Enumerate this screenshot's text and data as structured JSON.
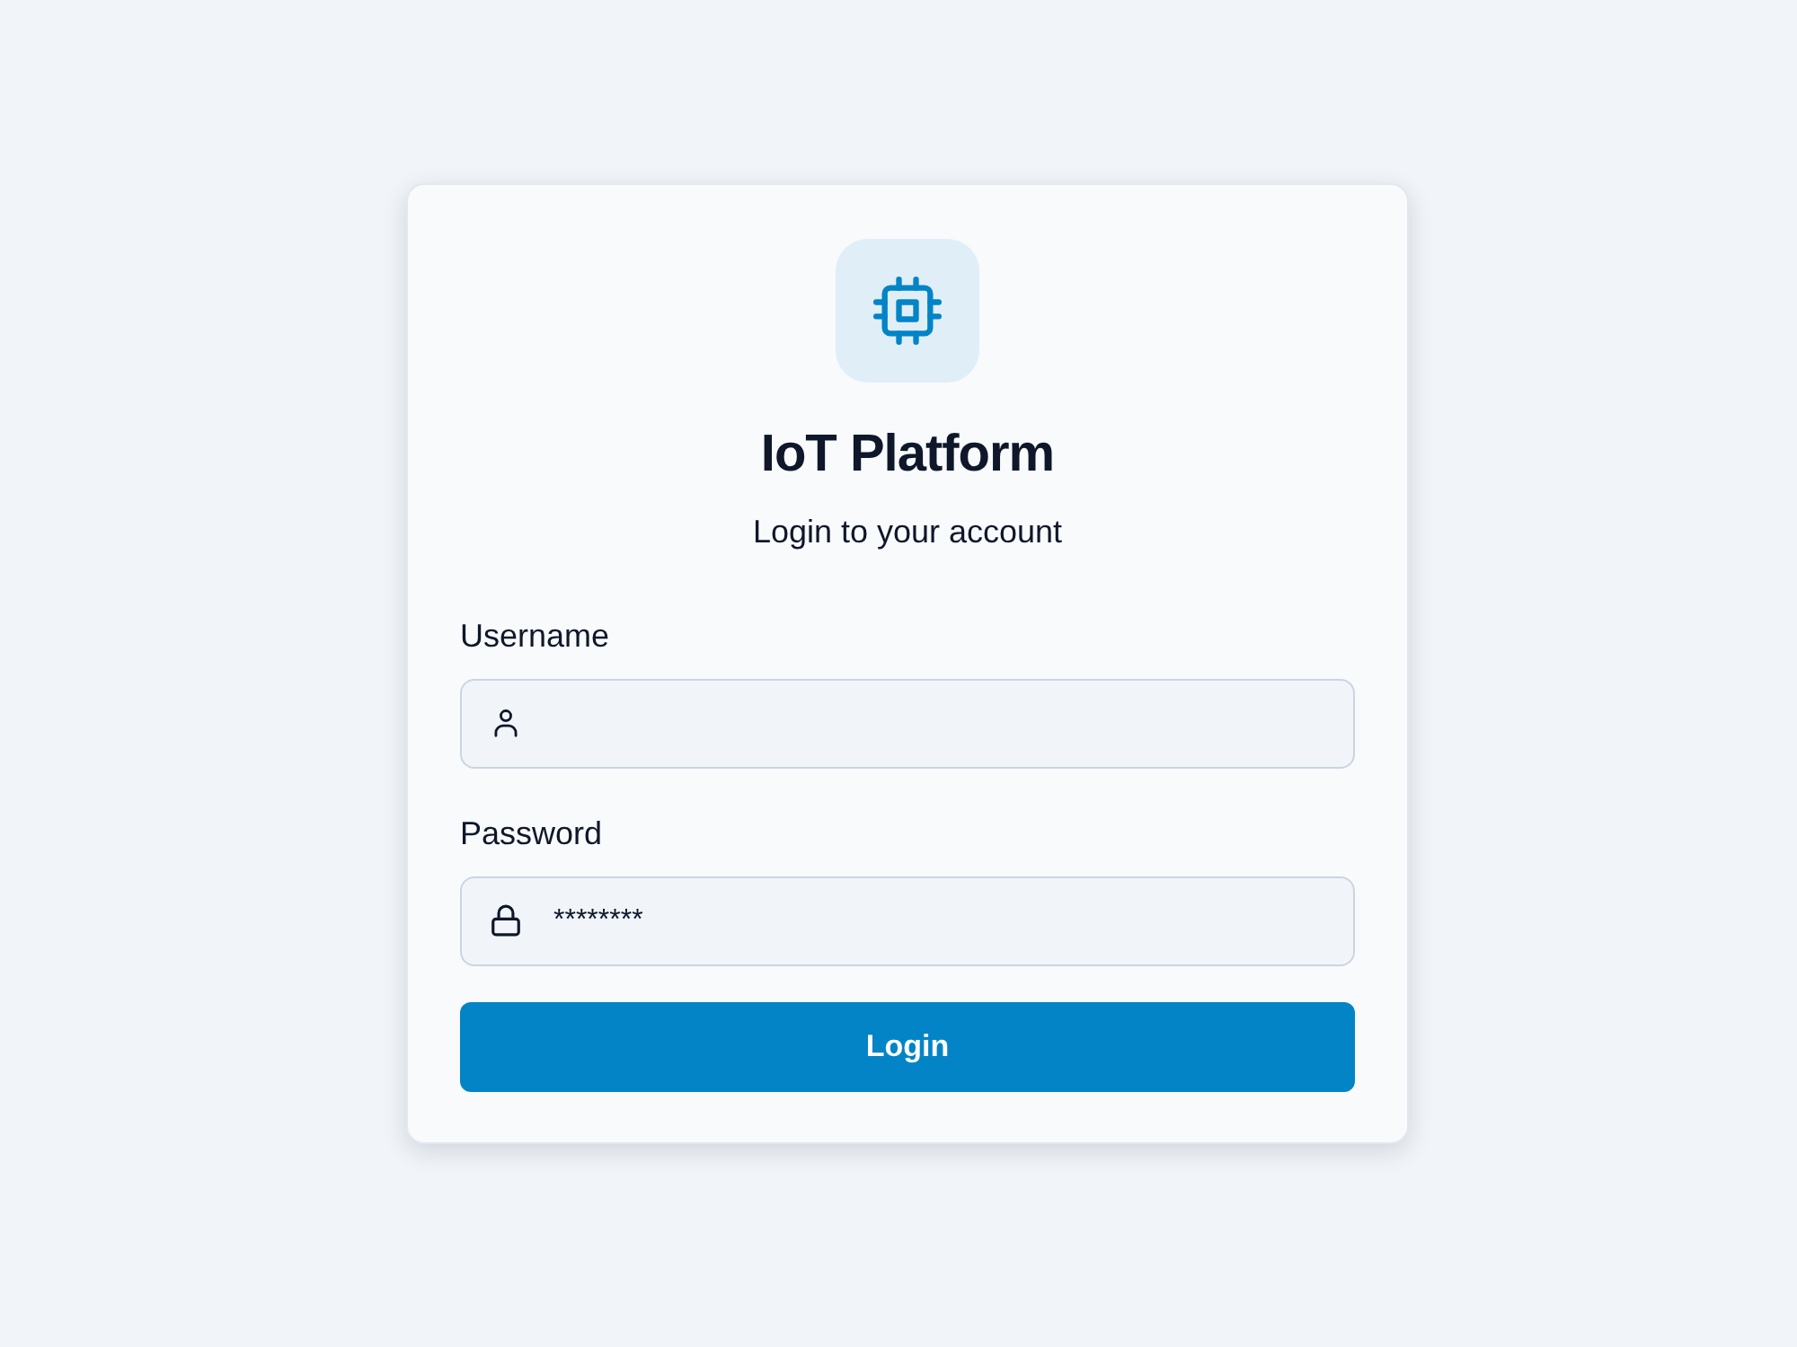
{
  "title": "IoT Platform",
  "subtitle": "Login to your account",
  "fields": [
    {
      "label": "Username",
      "kind": "user"
    },
    {
      "label": "Password",
      "kind": "lock",
      "value": "********"
    }
  ],
  "submit_button": "Login"
}
